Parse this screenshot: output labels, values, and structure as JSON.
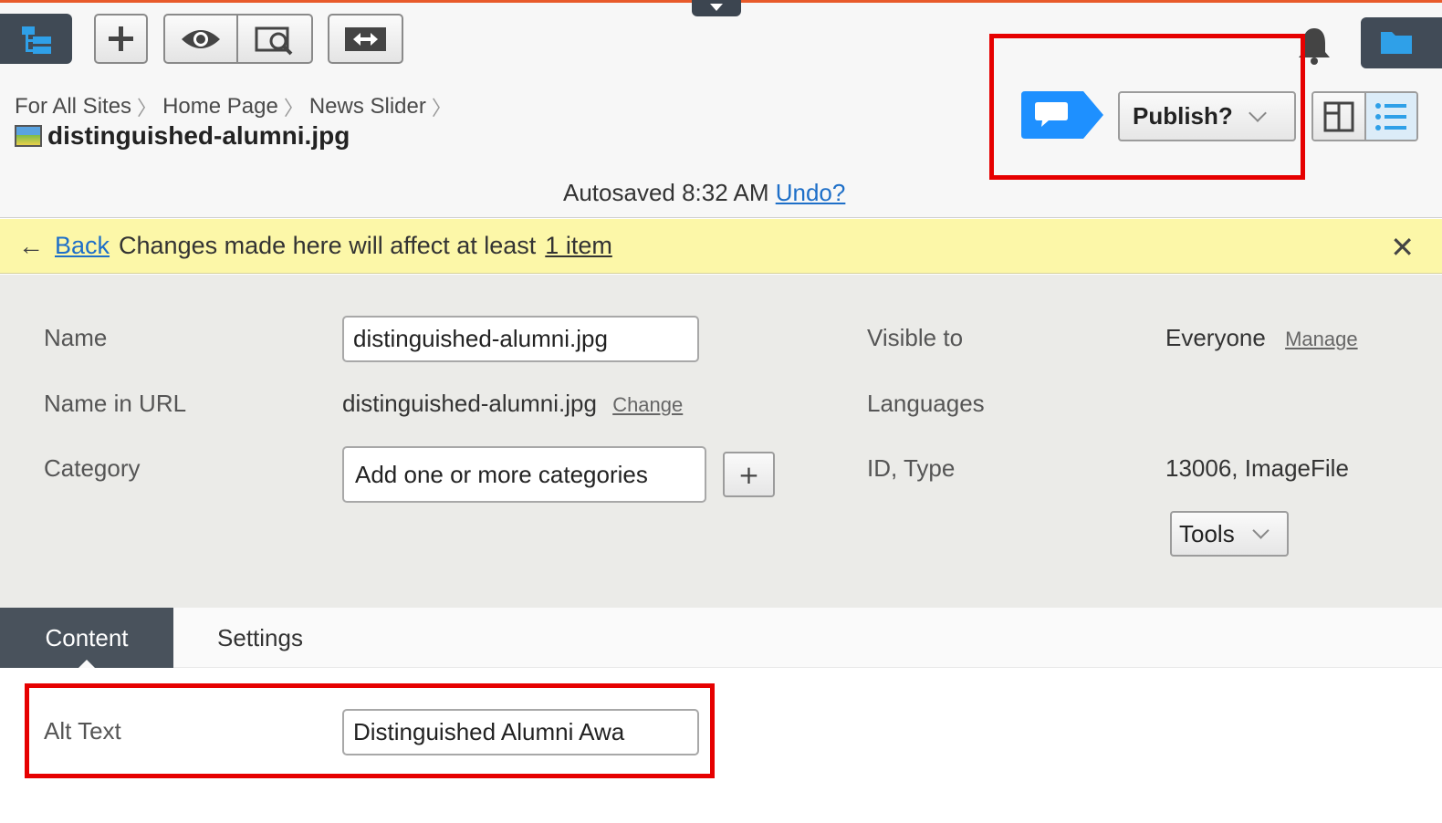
{
  "toolbar": {
    "tree_icon": "site-tree-icon",
    "add_icon": "plus-icon",
    "preview_icon": "eye-icon",
    "search_preview_icon": "magnify-page-icon",
    "compare_icon": "split-arrows-icon",
    "notifications_icon": "bell-icon",
    "folder_icon": "folder-icon"
  },
  "breadcrumb": {
    "items": [
      "For All Sites",
      "Home Page",
      "News Slider"
    ],
    "current": "distinguished-alumni.jpg"
  },
  "status": {
    "autosaved": "Autosaved 8:32 AM",
    "undo_label": "Undo?"
  },
  "actions": {
    "comment_icon": "speech-bubble-icon",
    "publish_label": "Publish?",
    "layout_split_icon": "split-view-icon",
    "layout_list_icon": "list-view-icon"
  },
  "notice": {
    "back_label": "Back",
    "message": "Changes made here will affect at least",
    "item_link": "1 item",
    "close_icon": "close-icon"
  },
  "properties": {
    "name_label": "Name",
    "name_value": "distinguished-alumni.jpg",
    "url_label": "Name in URL",
    "url_value": "distinguished-alumni.jpg",
    "url_change": "Change",
    "category_label": "Category",
    "category_placeholder": "Add one or more categories",
    "category_add": "+",
    "visible_label": "Visible to",
    "visible_value": "Everyone",
    "visible_manage": "Manage",
    "languages_label": "Languages",
    "id_label": "ID, Type",
    "id_value": "13006, ImageFile",
    "tools_label": "Tools"
  },
  "tabs": [
    {
      "label": "Content",
      "active": true
    },
    {
      "label": "Settings",
      "active": false
    }
  ],
  "content": {
    "alt_label": "Alt Text",
    "alt_value": "Distinguished Alumni Awa"
  },
  "colors": {
    "accent_blue": "#1e90ff",
    "highlight_red": "#e60000",
    "notice_yellow": "#fcf7a8",
    "dark_slate": "#404a55"
  }
}
